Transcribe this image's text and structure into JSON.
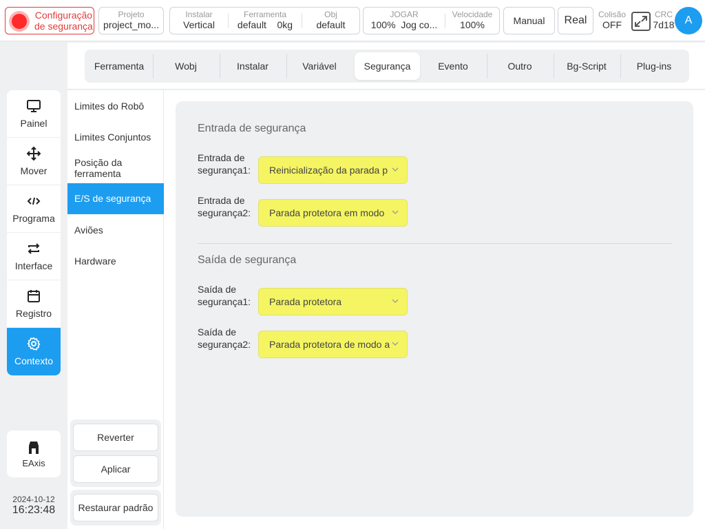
{
  "topbar": {
    "safety": {
      "line1": "Configuração",
      "line2": "de segurança"
    },
    "project": {
      "label": "Projeto",
      "value": "project_mo..."
    },
    "install": {
      "label": "Instalar",
      "value": "Vertical"
    },
    "tool": {
      "label": "Ferramenta",
      "value1": "default",
      "value2": "0kg"
    },
    "obj": {
      "label": "Obj",
      "value": "default"
    },
    "jog": {
      "label": "JOGAR",
      "value1": "100%",
      "value2": "Jog co..."
    },
    "speed": {
      "label": "Velocidade",
      "value": "100%"
    },
    "manual_label": "Manual",
    "real_label": "Real",
    "collision": {
      "label": "Colisão",
      "value": "OFF"
    },
    "crc": {
      "label": "CRC",
      "value": "7d18"
    },
    "avatar": "A"
  },
  "leftnav": {
    "items": [
      {
        "label": "Painel",
        "icon": "monitor-icon"
      },
      {
        "label": "Mover",
        "icon": "move-arrows-icon"
      },
      {
        "label": "Programa",
        "icon": "code-icon"
      },
      {
        "label": "Interface",
        "icon": "swap-arrows-icon"
      },
      {
        "label": "Registro",
        "icon": "calendar-icon"
      },
      {
        "label": "Contexto",
        "icon": "gear-icon"
      }
    ],
    "active_index": 5,
    "eaxis_label": "EAxis"
  },
  "datetime": {
    "date": "2024-10-12",
    "time": "16:23:48"
  },
  "tabs": {
    "items": [
      "Ferramenta",
      "Wobj",
      "Instalar",
      "Variável",
      "Segurança",
      "Evento",
      "Outro",
      "Bg-Script",
      "Plug-ins"
    ],
    "active_index": 4
  },
  "subnav": {
    "items": [
      "Limites do Robô",
      "Limites Conjuntos",
      "Posição da ferramenta",
      "E/S de segurança",
      "Aviões",
      "Hardware"
    ],
    "active_index": 3,
    "revert_label": "Reverter",
    "apply_label": "Aplicar",
    "restore_label": "Restaurar padrão"
  },
  "main": {
    "input_section_title": "Entrada de segurança",
    "inputs": [
      {
        "label_line1": "Entrada de",
        "label_line2": "segurança1:",
        "value": "Reinicialização da parada p"
      },
      {
        "label_line1": "Entrada de",
        "label_line2": "segurança2:",
        "value": "Parada protetora em modo"
      }
    ],
    "output_section_title": "Saída de segurança",
    "outputs": [
      {
        "label_line1": "Saída de",
        "label_line2": "segurança1:",
        "value": "Parada protetora"
      },
      {
        "label_line1": "Saída de",
        "label_line2": "segurança2:",
        "value": "Parada protetora de modo a"
      }
    ]
  },
  "colors": {
    "accent": "#1c9df0",
    "alarm": "#e23b3b",
    "select_bg": "#f5f563"
  }
}
